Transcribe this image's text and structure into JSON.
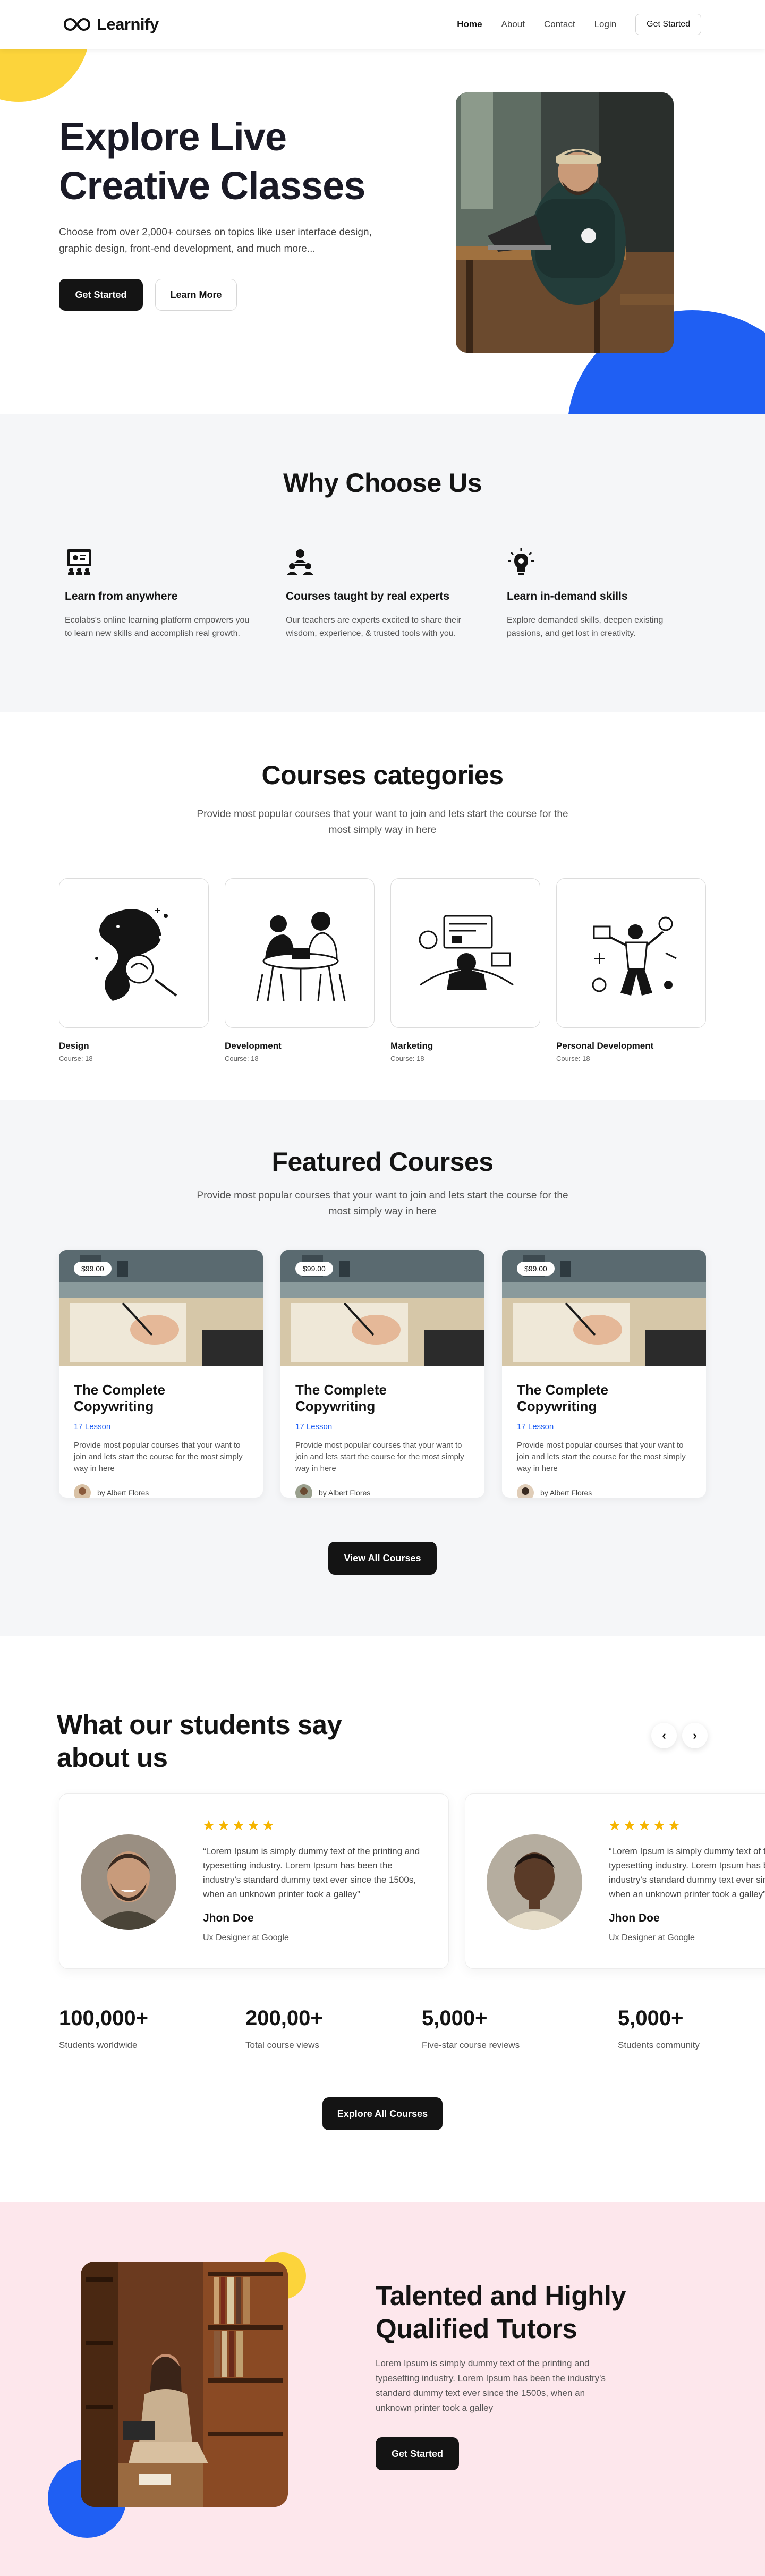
{
  "nav": {
    "brand": "Learnify",
    "links": [
      "Home",
      "About",
      "Contact",
      "Login"
    ],
    "cta": "Get Started"
  },
  "hero": {
    "title": "Explore Live Creative Classes",
    "text": "Choose from over 2,000+ courses on topics like user interface design, graphic design, front-end development, and much more...",
    "primary": "Get Started",
    "secondary": "Learn More"
  },
  "why": {
    "title": "Why Choose Us",
    "features": [
      {
        "icon": "presentation-icon",
        "title": "Learn from anywhere",
        "text": "Ecolabs's online learning platform empowers you to learn new skills and accomplish real growth."
      },
      {
        "icon": "experts-icon",
        "title": "Courses taught by real experts",
        "text": "Our teachers are experts excited to share their wisdom, experience, & trusted tools with you."
      },
      {
        "icon": "lightbulb-head-icon",
        "title": "Learn in-demand skills",
        "text": "Explore demanded skills, deepen existing passions, and get lost in creativity."
      }
    ]
  },
  "categories": {
    "title": "Courses categories",
    "subtitle": "Provide most popular courses that your want to join and lets start the course for the most simply way in here",
    "items": [
      {
        "name": "Design",
        "count": "Course: 18"
      },
      {
        "name": "Development",
        "count": "Course: 18"
      },
      {
        "name": "Marketing",
        "count": "Course: 18"
      },
      {
        "name": "Personal Development",
        "count": "Course: 18"
      }
    ]
  },
  "featured": {
    "title": "Featured Courses",
    "subtitle": "Provide most popular courses that your want to join and lets start the course for the most simply way in here",
    "courses": [
      {
        "price": "$99.00",
        "title": "The Complete Copywriting",
        "lesson": "17 Lesson",
        "desc": "Provide most popular courses that your want to join and lets start the course for the most simply way in here",
        "author": "by Albert Flores"
      },
      {
        "price": "$99.00",
        "title": "The Complete Copywriting",
        "lesson": "17 Lesson",
        "desc": "Provide most popular courses that your want to join and lets start the course for the most simply way in here",
        "author": "by Albert Flores"
      },
      {
        "price": "$99.00",
        "title": "The Complete Copywriting",
        "lesson": "17 Lesson",
        "desc": "Provide most popular courses that your want to join and lets start the course for the most simply way in here",
        "author": "by Albert Flores"
      }
    ],
    "cta": "View All Courses"
  },
  "testimonials": {
    "title": "What our students say about us",
    "prev_icon": "chevron-left-icon",
    "next_icon": "chevron-right-icon",
    "rating": 5,
    "items": [
      {
        "quote": "“Lorem Ipsum is simply dummy text of the printing and typesetting industry. Lorem Ipsum has been the industry's standard dummy text ever since the 1500s, when an unknown printer took a galley”",
        "name": "Jhon Doe",
        "role": "Ux Designer at Google"
      },
      {
        "quote": "“Lorem Ipsum is simply dummy text of the printing and typesetting industry. Lorem Ipsum has been the industry's standard dummy text ever since the 1500s, when an unknown printer took a galley”",
        "name": "Jhon Doe",
        "role": "Ux Designer at Google"
      }
    ],
    "stats": [
      {
        "value": "100,000+",
        "label": "Students worldwide"
      },
      {
        "value": "200,00+",
        "label": "Total course views"
      },
      {
        "value": "5,000+",
        "label": "Five-star course reviews"
      },
      {
        "value": "5,000+",
        "label": "Students community"
      }
    ],
    "cta": "Explore All Courses"
  },
  "tutors": {
    "title": "Talented and Highly Qualified Tutors",
    "text": "Lorem Ipsum is simply dummy text of the printing and typesetting industry. Lorem Ipsum has been the industry's standard dummy text ever since the 1500s, when an unknown printer took a galley",
    "cta": "Get Started"
  },
  "colors": {
    "accent_blue": "#1f5ff3",
    "accent_yellow": "#fcd43b",
    "dark": "#141414",
    "section_gray": "#f5f6f8",
    "pink": "#fde7ec",
    "star": "#f5b400"
  }
}
